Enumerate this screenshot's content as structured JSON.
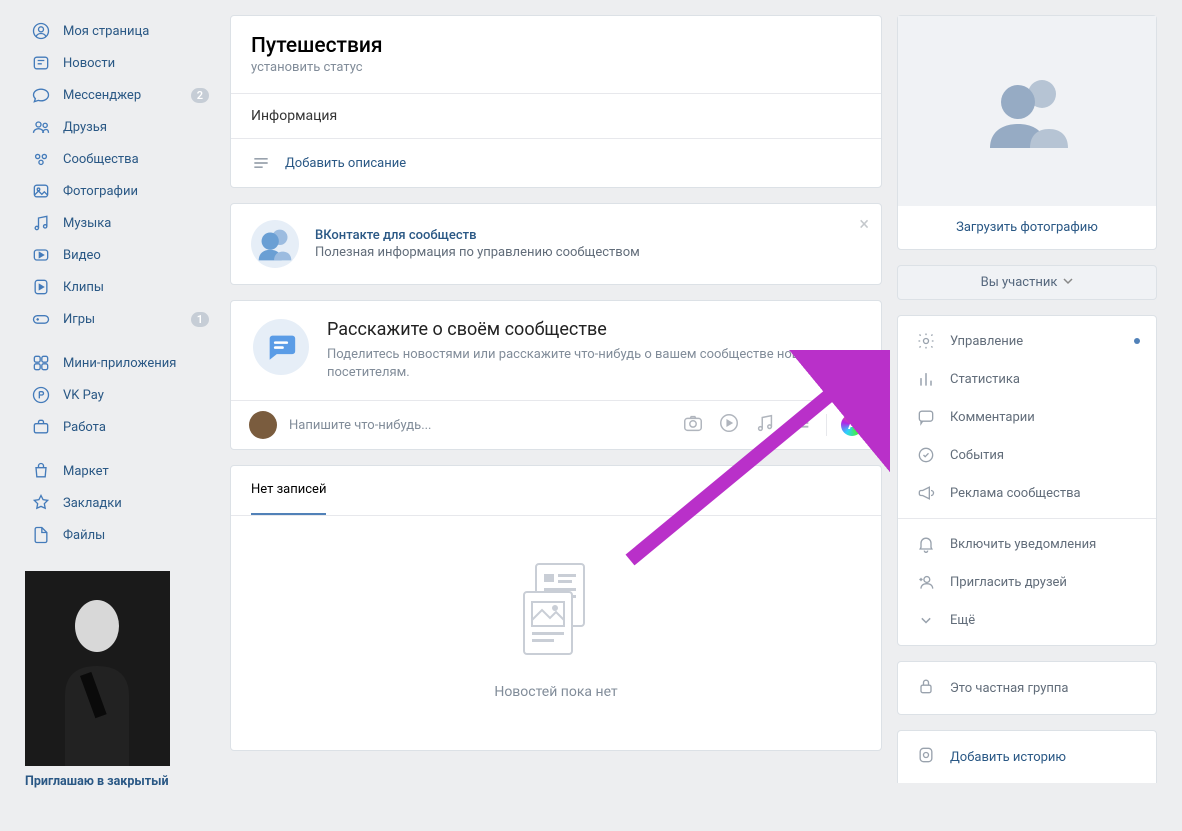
{
  "sidebar": {
    "items": [
      {
        "label": "Моя страница",
        "icon": "profile"
      },
      {
        "label": "Новости",
        "icon": "news"
      },
      {
        "label": "Мессенджер",
        "icon": "messenger",
        "badge": "2"
      },
      {
        "label": "Друзья",
        "icon": "friends"
      },
      {
        "label": "Сообщества",
        "icon": "communities"
      },
      {
        "label": "Фотографии",
        "icon": "photos"
      },
      {
        "label": "Музыка",
        "icon": "music"
      },
      {
        "label": "Видео",
        "icon": "video"
      },
      {
        "label": "Клипы",
        "icon": "clips"
      },
      {
        "label": "Игры",
        "icon": "games",
        "badge": "1"
      }
    ],
    "items2": [
      {
        "label": "Мини-приложения",
        "icon": "miniapps"
      },
      {
        "label": "VK Pay",
        "icon": "vkpay"
      },
      {
        "label": "Работа",
        "icon": "work"
      }
    ],
    "items3": [
      {
        "label": "Маркет",
        "icon": "market"
      },
      {
        "label": "Закладки",
        "icon": "bookmarks"
      },
      {
        "label": "Файлы",
        "icon": "files"
      }
    ],
    "promo_title": "Приглашаю в закрытый"
  },
  "header": {
    "title": "Путешествия",
    "status": "установить статус",
    "info": "Информация",
    "add_description": "Добавить описание"
  },
  "vk_promo": {
    "title": "ВКонтакте для сообществ",
    "text": "Полезная информация по управлению сообществом"
  },
  "tell": {
    "title": "Расскажите о своём сообществе",
    "text": "Поделитесь новостями или расскажите что-нибудь о вашем сообществе новым посетителям.",
    "placeholder": "Напишите что-нибудь..."
  },
  "tabs": {
    "no_posts": "Нет записей"
  },
  "empty": {
    "text": "Новостей пока нет"
  },
  "right": {
    "upload_photo": "Загрузить фотографию",
    "you_member": "Вы участник",
    "menu": [
      {
        "label": "Управление",
        "icon": "gear",
        "dot": true
      },
      {
        "label": "Статистика",
        "icon": "stats"
      },
      {
        "label": "Комментарии",
        "icon": "comments"
      },
      {
        "label": "События",
        "icon": "events"
      },
      {
        "label": "Реклама сообщества",
        "icon": "ads"
      },
      {
        "label": "Включить уведомления",
        "icon": "bell"
      },
      {
        "label": "Пригласить друзей",
        "icon": "invite"
      },
      {
        "label": "Ещё",
        "icon": "more"
      }
    ],
    "private": "Это частная группа",
    "add_story": "Добавить историю"
  },
  "colors": {
    "link": "#2a5885",
    "muted": "#818c99",
    "accent": "#5181b8"
  }
}
